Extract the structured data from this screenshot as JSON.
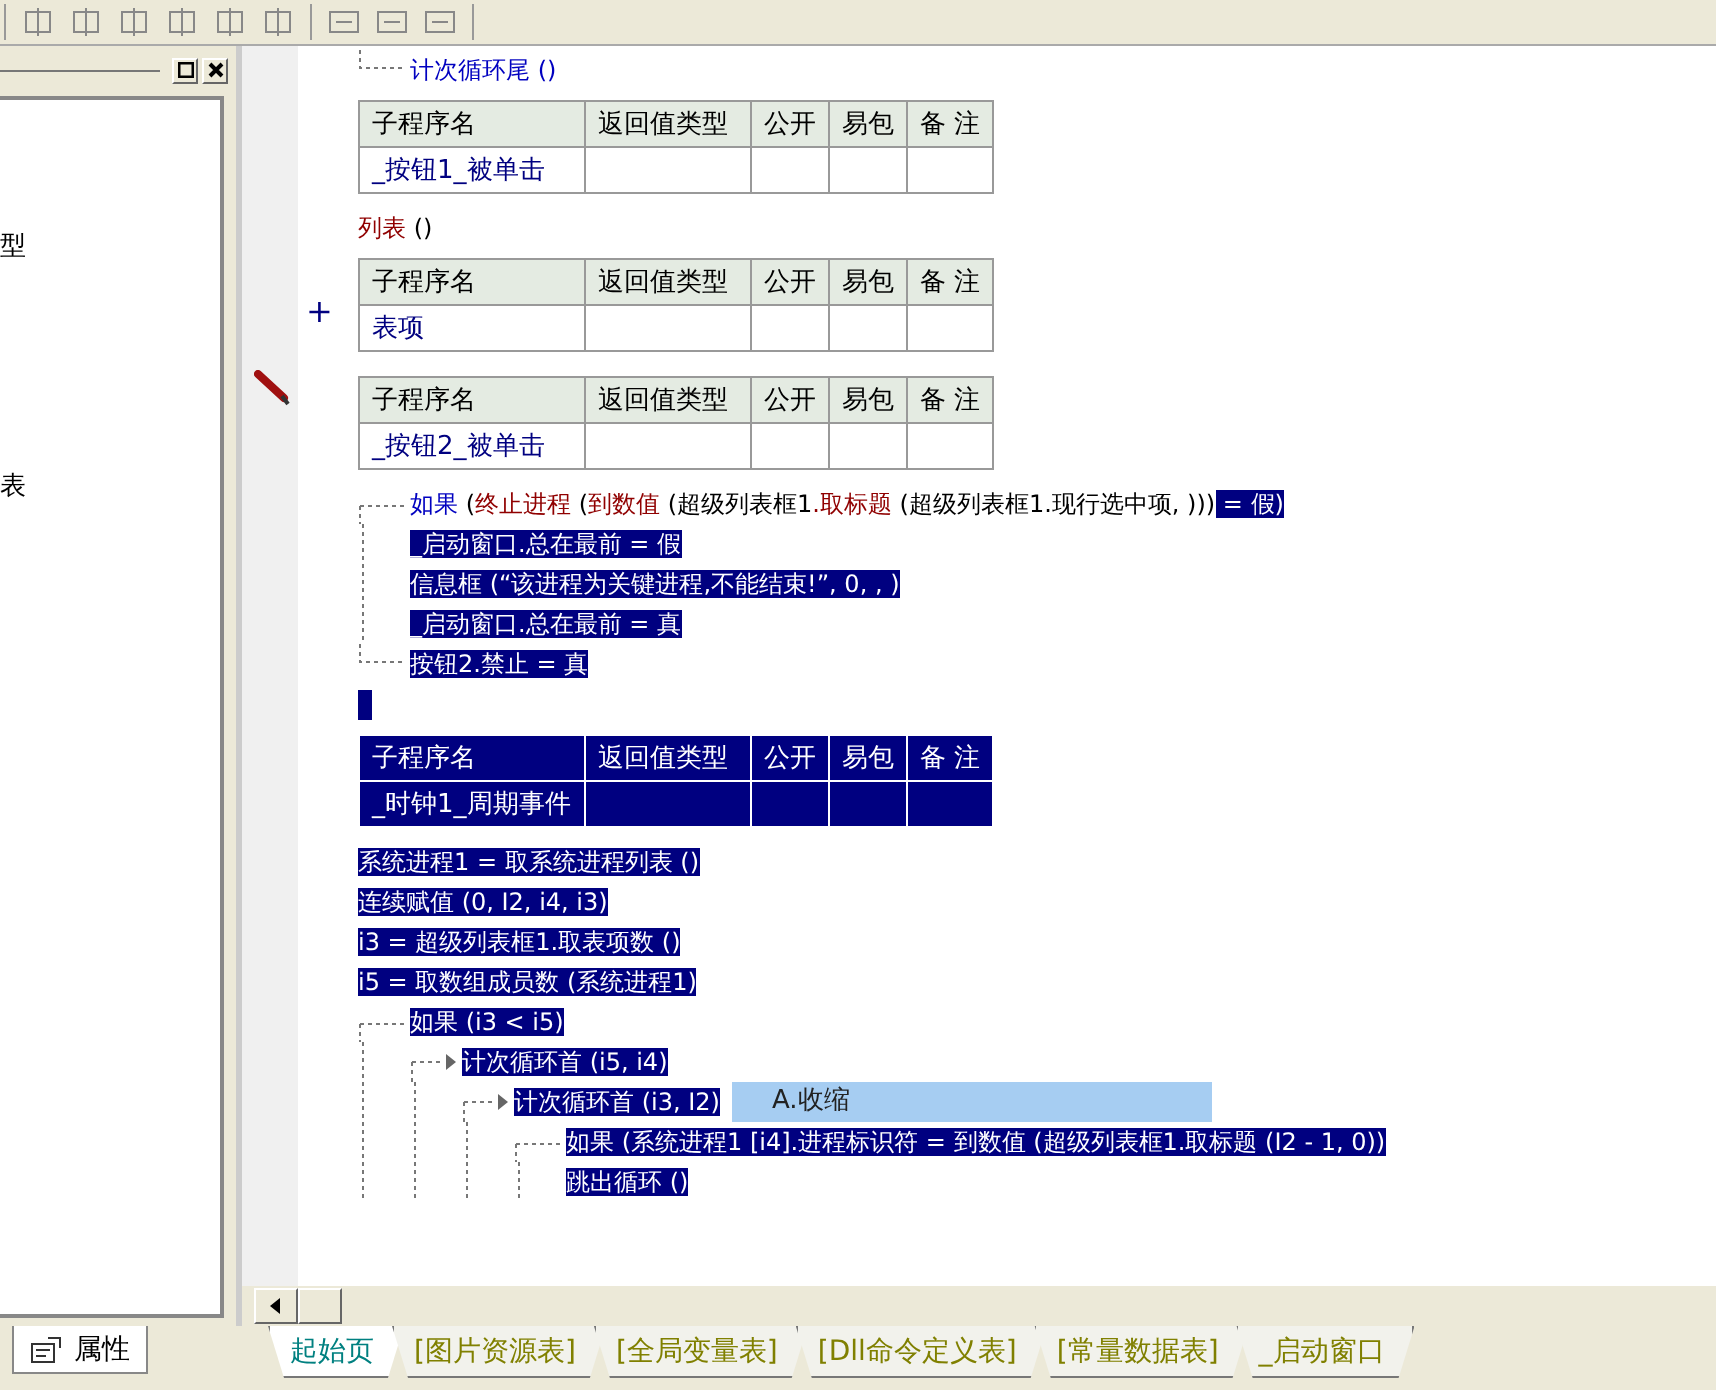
{
  "left_panel": {
    "fragments": [
      "型",
      "表"
    ],
    "tab": {
      "label": "属性",
      "selected": true
    }
  },
  "code": [
    {
      "kind": "branch-end",
      "segments": [
        {
          "text": "计次循环尾 ()",
          "kind": "keyword",
          "selected": false
        }
      ]
    },
    {
      "kind": "table",
      "selected": false,
      "columns": [
        "子程序名",
        "返回值类型",
        "公开",
        "易包",
        "备 注"
      ],
      "rows": [
        {
          "name": "_按钮1_被单击"
        }
      ]
    },
    {
      "kind": "line",
      "segments": [
        {
          "text": "列表",
          "kind": "command",
          "selected": false
        },
        {
          "text": " ()",
          "kind": "plain",
          "selected": false
        }
      ]
    },
    {
      "kind": "table",
      "selected": false,
      "gutter_mark": "+",
      "columns": [
        "子程序名",
        "返回值类型",
        "公开",
        "易包",
        "备 注"
      ],
      "rows": [
        {
          "name": "表项"
        }
      ]
    },
    {
      "kind": "table",
      "selected": false,
      "editing": true,
      "columns": [
        "子程序名",
        "返回值类型",
        "公开",
        "易包",
        "备 注"
      ],
      "rows": [
        {
          "name": "_按钮2_被单击"
        }
      ]
    },
    {
      "kind": "branch",
      "segments": [
        {
          "text": "如果",
          "kind": "keyword",
          "selected": false
        },
        {
          "text": " (",
          "kind": "plain",
          "selected": false
        },
        {
          "text": "终止进程",
          "kind": "command",
          "selected": false
        },
        {
          "text": " (",
          "kind": "plain",
          "selected": false
        },
        {
          "text": "到数值",
          "kind": "command",
          "selected": false
        },
        {
          "text": " (超级列表框1",
          "kind": "plain",
          "selected": false
        },
        {
          "text": ".取标题",
          "kind": "command",
          "selected": false
        },
        {
          "text": " (超级列表框1.现行选中项, )))",
          "kind": "plain",
          "selected": false
        },
        {
          "text": " = 假)",
          "selected": true
        }
      ],
      "children": [
        {
          "kind": "line",
          "segments": [
            {
              "text": "_启动窗口.总在最前 = 假",
              "selected": true
            }
          ]
        },
        {
          "kind": "line",
          "segments": [
            {
              "text": "信息框 (“该进程为关键进程,不能结束!”, 0, , )",
              "selected": true
            }
          ]
        },
        {
          "kind": "line",
          "segments": [
            {
              "text": "_启动窗口.总在最前 = 真",
              "selected": true
            }
          ]
        }
      ]
    },
    {
      "kind": "branch-end",
      "segments": [
        {
          "text": "按钮2.禁止 = 真",
          "selected": true
        }
      ]
    },
    {
      "kind": "cursor",
      "selected": true
    },
    {
      "kind": "table",
      "selected": true,
      "columns": [
        "子程序名",
        "返回值类型",
        "公开",
        "易包",
        "备 注"
      ],
      "rows": [
        {
          "name": "_时钟1_周期事件"
        }
      ]
    },
    {
      "kind": "line",
      "segments": [
        {
          "text": "系统进程1 = 取系统进程列表 ()",
          "selected": true
        }
      ]
    },
    {
      "kind": "line",
      "segments": [
        {
          "text": "连续赋值 (0, I2, i4, i3)",
          "selected": true
        }
      ]
    },
    {
      "kind": "line",
      "segments": [
        {
          "text": "i3 = 超级列表框1.取表项数 ()",
          "selected": true
        }
      ]
    },
    {
      "kind": "line",
      "segments": [
        {
          "text": "i5 = 取数组成员数 (系统进程1)",
          "selected": true
        }
      ]
    },
    {
      "kind": "branch",
      "segments": [
        {
          "text": "如果 (i3 < i5)",
          "selected": true
        }
      ],
      "children": [
        {
          "kind": "loop",
          "segments": [
            {
              "text": "计次循环首 (i5, i4)",
              "selected": true
            }
          ],
          "children": [
            {
              "kind": "loop",
              "tooltip": "A.收缩",
              "segments": [
                {
                  "text": "计次循环首 (i3, I2)",
                  "selected": true
                }
              ],
              "children": [
                {
                  "kind": "branch",
                  "segments": [
                    {
                      "text": "如果 (系统进程1 [i4].进程标识符 = 到数值 (超级列表框1.取标题 (I2 - 1, 0))",
                      "selected": true
                    }
                  ],
                  "children": [
                    {
                      "kind": "line",
                      "segments": [
                        {
                          "text": "跳出循环 ()",
                          "selected": true
                        }
                      ]
                    }
                  ]
                }
              ]
            }
          ]
        }
      ]
    }
  ],
  "bottom_tabs": [
    {
      "label": "起始页",
      "selected": true
    },
    {
      "label": "[图片资源表]",
      "selected": false
    },
    {
      "label": "[全局变量表]",
      "selected": false
    },
    {
      "label": "[Dll命令定义表]",
      "selected": false
    },
    {
      "label": "[常量数据表]",
      "selected": false
    },
    {
      "label": "_启动窗口",
      "selected": false
    }
  ]
}
